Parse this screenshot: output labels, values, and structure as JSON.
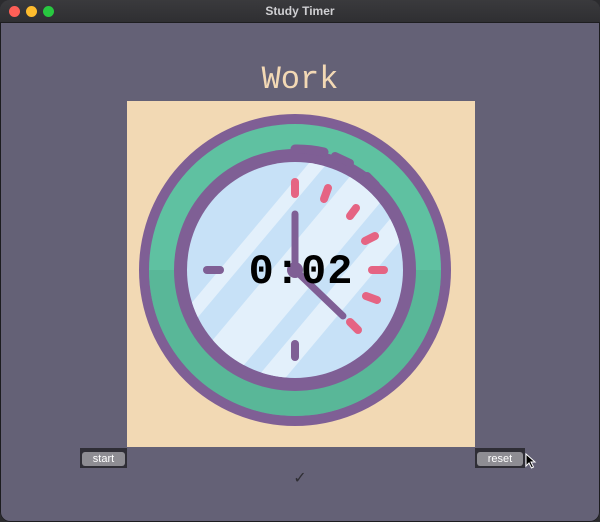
{
  "window": {
    "title": "Study Timer"
  },
  "main": {
    "heading": "Work",
    "timer": "0:02",
    "checkmarks": "✓"
  },
  "buttons": {
    "start_label": "start",
    "reset_label": "reset"
  },
  "colors": {
    "background": "#646176",
    "heading": "#f3d9b5",
    "clock_background": "#f2d9b4",
    "clock_rim": "#7f5f95",
    "clock_teal": "#5fc1a1",
    "clock_face": "#c7e1f7",
    "tick_marks": "#e56483"
  },
  "icons": {
    "clock_image": "tomato-clock-illustration",
    "checkmark": "check-icon"
  }
}
